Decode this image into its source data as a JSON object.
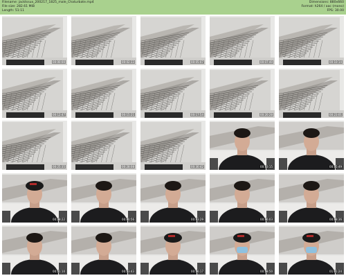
{
  "header": {
    "filename": "Filename: jacktssux_200217_1825_male_Chaturbate.mp4",
    "filesize": "File size: 282.61 MiB",
    "length": "Length: 51:11",
    "dimensions": "Dimensions: 880x660",
    "format": "Format: h264 / aac (mono)",
    "fps": "FPS: 30.00"
  },
  "thumbnails": [
    {
      "scene": "pier",
      "time": "00:00:00"
    },
    {
      "scene": "pier",
      "time": "00:02:33"
    },
    {
      "scene": "pier",
      "time": "00:05:07"
    },
    {
      "scene": "pier",
      "time": "00:07:40"
    },
    {
      "scene": "pier",
      "time": "00:10:14"
    },
    {
      "scene": "pier",
      "time": "00:12:47"
    },
    {
      "scene": "pier",
      "time": "00:15:21"
    },
    {
      "scene": "pier",
      "time": "00:17:54"
    },
    {
      "scene": "pier",
      "time": "00:20:28"
    },
    {
      "scene": "pier",
      "time": "00:23:01"
    },
    {
      "scene": "pier",
      "time": "00:25:35"
    },
    {
      "scene": "pier",
      "time": "00:28:08"
    },
    {
      "scene": "pier",
      "time": "00:30:42"
    },
    {
      "scene": "person",
      "time": "00:33:15"
    },
    {
      "scene": "person",
      "time": "00:35:49"
    },
    {
      "scene": "person-cap",
      "time": "00:38:22"
    },
    {
      "scene": "person",
      "time": "00:40:56"
    },
    {
      "scene": "person",
      "time": "00:43:29"
    },
    {
      "scene": "person",
      "time": "00:46:03"
    },
    {
      "scene": "person",
      "time": "00:48:36"
    },
    {
      "scene": "person",
      "time": "00:51:10"
    },
    {
      "scene": "person",
      "time": "00:53:43"
    },
    {
      "scene": "person-cap",
      "time": "00:56:17"
    },
    {
      "scene": "person-cap-mask",
      "time": "00:58:50"
    },
    {
      "scene": "person-cap-mask",
      "time": "01:01:24"
    }
  ]
}
